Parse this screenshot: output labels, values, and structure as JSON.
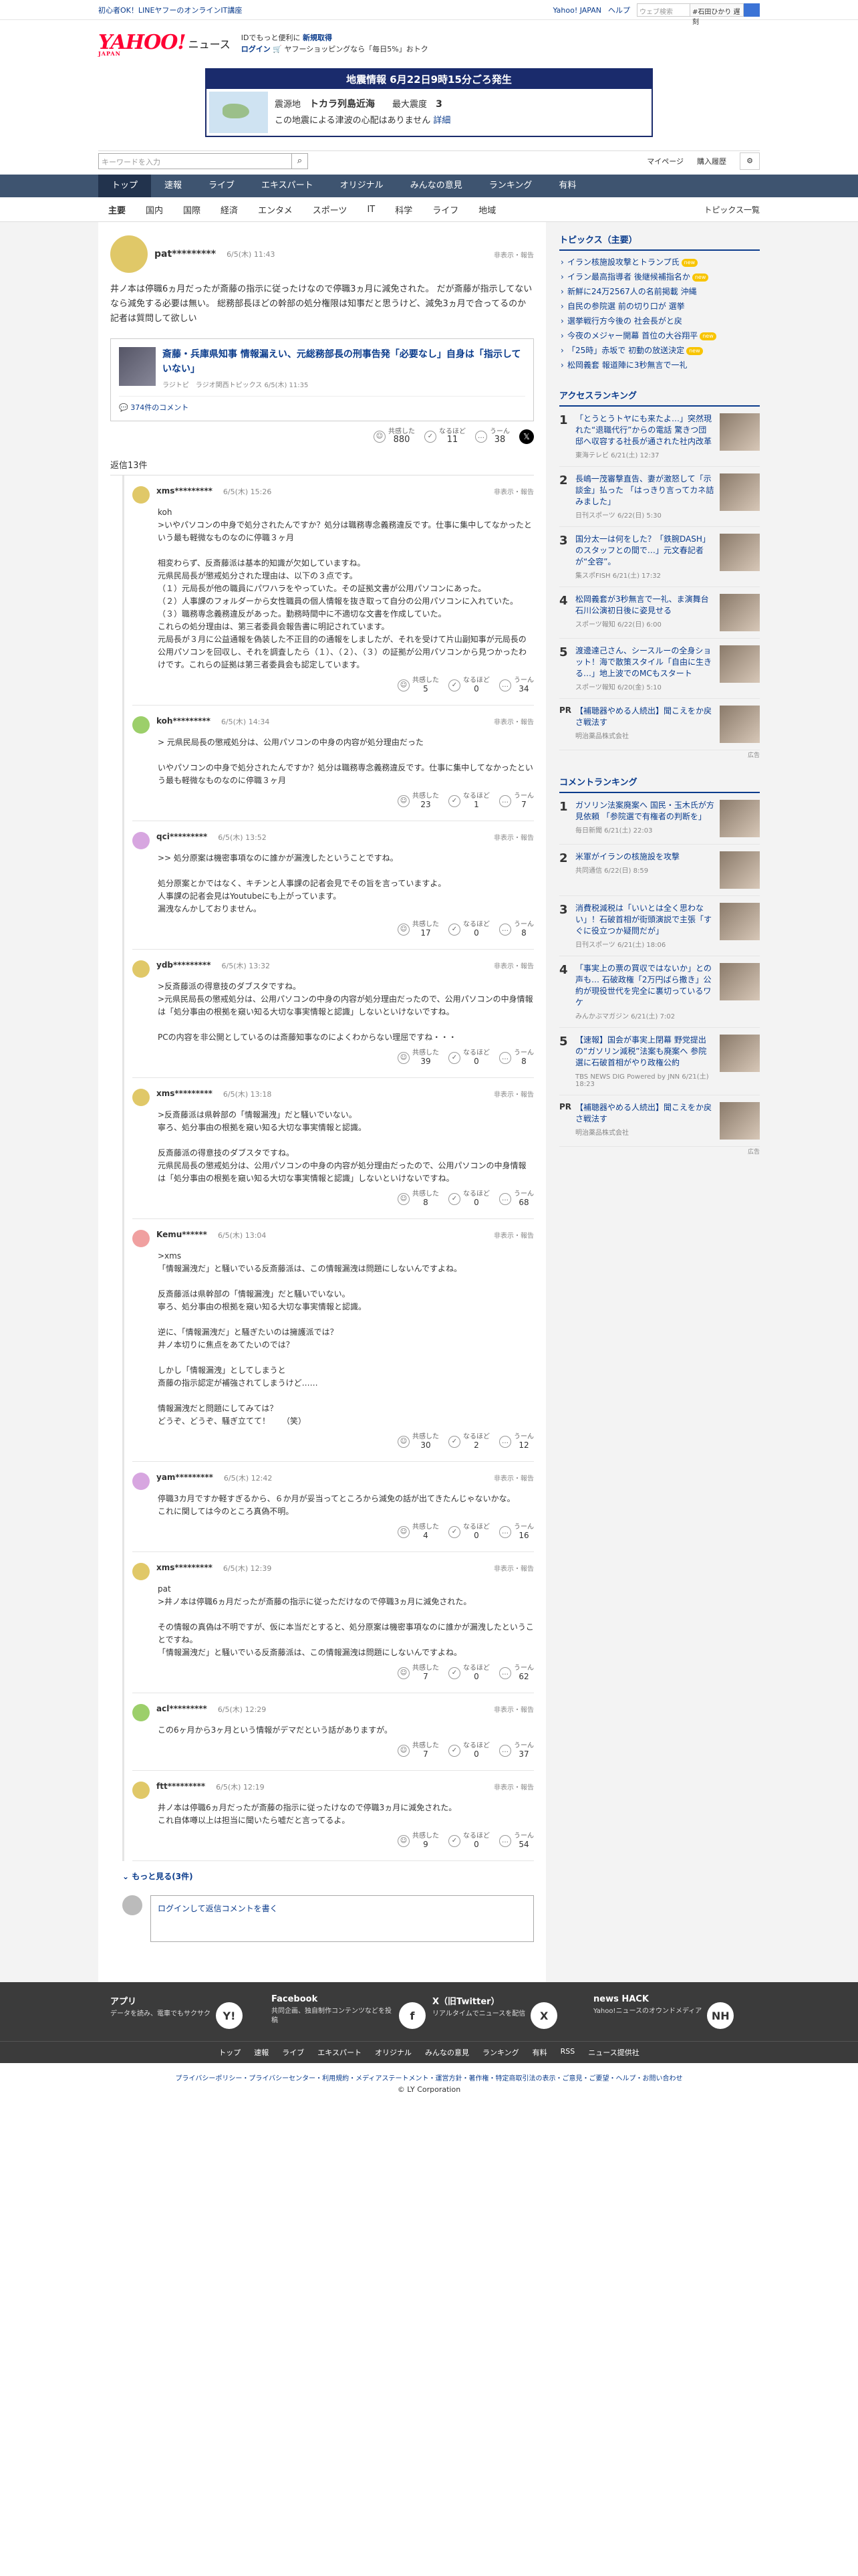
{
  "topbar": {
    "promo": "初心者OK！LINEヤフーのオンラインIT講座",
    "links": [
      "Yahoo! JAPAN",
      "ヘルプ"
    ],
    "search_placeholder": "ウェブ検索",
    "search_name": "#石田ひかり 遅刻"
  },
  "header": {
    "logo": "YAHOO!",
    "logo_sub": "JAPAN",
    "section": "ニュース",
    "line1_a": "IDでもっと便利に",
    "line1_b": "新規取得",
    "line2_a": "ログイン",
    "line2_b": "ヤフーショッピングなら「毎日5%」おトク"
  },
  "quake": {
    "title": "地震情報 6月22日9時15分ごろ発生",
    "loc_label": "震源地",
    "loc": "トカラ列島近海",
    "int_label": "最大震度",
    "int": "3",
    "note": "この地震による津波の心配はありません",
    "detail": "詳細"
  },
  "bar": {
    "search_placeholder": "キーワードを入力",
    "mypage": "マイページ",
    "history": "購入履歴"
  },
  "nav": [
    "トップ",
    "速報",
    "ライブ",
    "エキスパート",
    "オリジナル",
    "みんなの意見",
    "ランキング",
    "有料"
  ],
  "subnav": [
    "主要",
    "国内",
    "国際",
    "経済",
    "エンタメ",
    "スポーツ",
    "IT",
    "科学",
    "ライフ",
    "地域"
  ],
  "subnav_all": "トピックス一覧",
  "post": {
    "user": "pat*********",
    "date": "6/5(木) 11:43",
    "hide": "非表示・報告",
    "body": "井ノ本は停職6ヵ月だったが斎藤の指示に従ったけなので停職3ヵ月に減免された。 だが斎藤が指示してないなら減免する必要は無い。 総務部長ほどの幹部の処分権限は知事だと思うけど、減免3ヵ月で合ってるのか記者は質問して欲しい",
    "article_title": "斎藤・兵庫県知事 情報漏えい、元総務部長の刑事告発「必要なし」自身は「指示していない」",
    "article_src": "ラジトピ　ラジオ関西トピックス 6/5(木) 11:35",
    "article_count": "374件のコメント",
    "r1_label": "共感した",
    "r1": "880",
    "r2_label": "なるほど",
    "r2": "11",
    "r3_label": "うーん",
    "r3": "38"
  },
  "reply_count": "返信13件",
  "replies": [
    {
      "user": "xms*********",
      "date": "6/5(木) 15:26",
      "body": "koh\n>いやパソコンの中身で処分されたんですか？処分は職務専念義務違反です。仕事に集中してなかったという最も軽微なものなのに停職３ヶ月\n\n相変わらず、反斎藤派は基本的知識が欠如していますね。\n元県民局長が懲戒処分された理由は、以下の３点です。\n（１）元局長が他の職員にパワハラをやっていた。その証拠文書が公用パソコンにあった。\n（２）人事課のフォルダーから女性職員の個人情報を抜き取って自分の公用パソコンに入れていた。\n（３）職務専念義務違反があった。勤務時間中に不適切な文書を作成していた。\nこれらの処分理由は、第三者委員会報告書に明記されています。\n元局長が３月に公益通報を偽装した不正目的の通報をしましたが、それを受けて片山副知事が元局長の公用パソコンを回収し、それを調査したら（１）、（２）、（３）の証拠が公用パソコンから見つかったわけです。これらの証拠は第三者委員会も認定しています。",
      "r1": "5",
      "r2": "0",
      "r3": "34"
    },
    {
      "user": "koh*********",
      "date": "6/5(木) 14:34",
      "body": "> 元県民局長の懲戒処分は、公用パソコンの中身の内容が処分理由だった\n\nいやパソコンの中身で処分されたんですか？処分は職務専念義務違反です。仕事に集中してなかったという最も軽微なものなのに停職３ヶ月",
      "r1": "23",
      "r2": "1",
      "r3": "7"
    },
    {
      "user": "qci*********",
      "date": "6/5(木) 13:52",
      "body": ">> 処分原案は機密事項なのに誰かが漏洩したということですね。\n\n処分原案とかではなく、キチンと人事課の記者会見でその旨を言っていますよ。\n人事課の記者会見はYoutubeにも上がっています。\n漏洩なんかしておりません。",
      "r1": "17",
      "r2": "0",
      "r3": "8"
    },
    {
      "user": "ydb*********",
      "date": "6/5(木) 13:32",
      "body": ">反斎藤派の得意技のダブスタですね。\n>元県民局長の懲戒処分は、公用パソコンの中身の内容が処分理由だったので、公用パソコンの中身情報は「処分事由の根拠を窺い知る大切な事実情報と認識」しないといけないですね。\n\nPCの内容を非公開としているのは斎藤知事なのによくわからない理屈ですね・・・",
      "r1": "39",
      "r2": "0",
      "r3": "8"
    },
    {
      "user": "xms*********",
      "date": "6/5(木) 13:18",
      "body": ">反斎藤派は県幹部の「情報漏洩」だと騒いでいない。\n寧ろ、処分事由の根拠を窺い知る大切な事実情報と認識。\n\n反斎藤派の得意技のダブスタですね。\n元県民局長の懲戒処分は、公用パソコンの中身の内容が処分理由だったので、公用パソコンの中身情報は「処分事由の根拠を窺い知る大切な事実情報と認識」しないといけないですね。",
      "r1": "8",
      "r2": "0",
      "r3": "68"
    },
    {
      "user": "Kemu******",
      "date": "6/5(木) 13:04",
      "body": ">xms\n「情報漏洩だ」と騒いでいる反斎藤派は、この情報漏洩は問題にしないんですよね。\n\n反斎藤派は県幹部の「情報漏洩」だと騒いでいない。\n寧ろ、処分事由の根拠を窺い知る大切な事実情報と認識。\n\n逆に、「情報漏洩だ」と騒ぎたいのは擁護派では？\n井ノ本切りに焦点をあてたいのでは？\n\nしかし「情報漏洩」としてしまうと\n斎藤の指示認定が補強されてしまうけど……\n\n情報漏洩だと問題にしてみては？\nどうぞ、どうぞ、騒ぎ立てて！　　（笑）",
      "r1": "30",
      "r2": "2",
      "r3": "12"
    },
    {
      "user": "yam*********",
      "date": "6/5(木) 12:42",
      "body": "停職3カ月ですか軽すぎるから、６か月が妥当ってところから減免の話が出てきたんじゃないかな。\nこれに関しては今のところ真偽不明。",
      "r1": "4",
      "r2": "0",
      "r3": "16"
    },
    {
      "user": "xms*********",
      "date": "6/5(木) 12:39",
      "body": "pat\n>井ノ本は停職6ヵ月だったが斎藤の指示に従っただけなので停職3ヵ月に減免された。\n\nその情報の真偽は不明ですが、仮に本当だとすると、処分原案は機密事項なのに誰かが漏洩したということですね。\n「情報漏洩だ」と騒いでいる反斎藤派は、この情報漏洩は問題にしないんですよね。",
      "r1": "7",
      "r2": "0",
      "r3": "62"
    },
    {
      "user": "acl*********",
      "date": "6/5(木) 12:29",
      "body": "この6ヶ月から3ヶ月という情報がデマだという話がありますが。",
      "r1": "7",
      "r2": "0",
      "r3": "37"
    },
    {
      "user": "ftt*********",
      "date": "6/5(木) 12:19",
      "body": "井ノ本は停職6ヵ月だったが斎藤の指示に従ったけなので停職3ヵ月に減免された。\nこれ自体噂以上は担当に聞いたら嘘だと言ってるよ。",
      "r1": "9",
      "r2": "0",
      "r3": "54"
    }
  ],
  "react_labels": [
    "共感した",
    "なるほど",
    "うーん"
  ],
  "hide_label": "非表示・報告",
  "more": "もっと見る(3件)",
  "comment_login": "ログイン",
  "comment_rest": "して返信コメントを書く",
  "side": {
    "topics_title": "トピックス（主要）",
    "topics": [
      "イラン核施設攻撃とトランプ氏",
      "イラン最高指導者 後継候補指名か",
      "新鮮に24万2567人の名前掲載 沖縄",
      "自民の参院選 前の切り口が 選挙",
      "選挙戦行方今後の 社会長がと戻",
      "今夜のメジャー開幕 首位の大谷翔平",
      "「25時」赤坂で 初動の放送決定",
      "松岡義套 報道陣に3秒無言で一礼"
    ],
    "access_title": "アクセスランキング",
    "access": [
      {
        "n": "1",
        "t": "「とうとうトヤにも来たよ…」突然現れた“退職代行”からの電話 驚きつ団邸へ収容する社長が通された社内改革",
        "s": "東海テレビ 6/21(土) 12:37"
      },
      {
        "n": "2",
        "t": "長嶋一茂審撃直告、妻が激怒して「示談金」払った 「はっきり言ってカネ詰みました」",
        "s": "日刊スポーツ 6/22(日) 5:30"
      },
      {
        "n": "3",
        "t": "国分太一は何をした？「鉄腕DASH」のスタッフとの間で…」元文春記者が“全容”。",
        "s": "集スポFISH 6/21(土) 17:32"
      },
      {
        "n": "4",
        "t": "松岡義套が3秒無言で一礼、ま演舞台石川公演初日後に姿見せる",
        "s": "スポーツ報知 6/22(日) 6:00"
      },
      {
        "n": "5",
        "t": "渡邊達己さん、シースルーの全身ショット！海で散策スタイル「自由に生きる…」地上波でのMCもスタート",
        "s": "スポーツ報知 6/20(金) 5:10"
      }
    ],
    "pr1": {
      "t": "【補聴器やめる人続出】聞こえをか戻さ戦法す",
      "s": "明治薬品株式会社"
    },
    "comment_title": "コメントランキング",
    "comments": [
      {
        "n": "1",
        "t": "ガソリン法案廃案へ 国民・玉木氏が方見依頼 「参院選で有権者の判断を」",
        "s": "毎日新聞 6/21(土) 22:03"
      },
      {
        "n": "2",
        "t": "米軍がイランの核施設を攻撃",
        "s": "共同通信 6/22(日) 8:59"
      },
      {
        "n": "3",
        "t": "消費税減税は「いいとは全く思わない」！石破首相が街頭演説で主張「すぐに役立つか疑問だが」",
        "s": "日刊スポーツ 6/21(土) 18:06"
      },
      {
        "n": "4",
        "t": "「事実上の票の買収ではないか」との声も… 石破政権「2万円ばら撒き」公約が現役世代を完全に裏切っているワケ",
        "s": "みんかぶマガジン 6/21(土) 7:02"
      },
      {
        "n": "5",
        "t": "【速報】国会が事実上閉幕 野党提出の“ガソリン減税”法案も廃案へ 参院選に石破首相がやり政権公約",
        "s": "TBS NEWS DIG Powered by JNN 6/21(土) 18:23"
      }
    ],
    "pr2": {
      "t": "【補聴器やめる人続出】聞こえをか戻さ戦法す",
      "s": "明治薬品株式会社"
    },
    "ad": "広告"
  },
  "footer": {
    "cols": [
      {
        "t": "アプリ",
        "d": "データを読み、電車でもサクサク",
        "icon": "Y!"
      },
      {
        "t": "Facebook",
        "d": "共同企画、独自制作コンテンツなどを投稿",
        "icon": "f"
      },
      {
        "t": "X（旧Twitter）",
        "d": "リアルタイムでニュースを配信",
        "icon": "X"
      },
      {
        "t": "news HACK",
        "d": "Yahoo!ニュースのオウンドメディア",
        "icon": "NH"
      }
    ],
    "links": [
      "トップ",
      "速報",
      "ライブ",
      "エキスパート",
      "オリジナル",
      "みんなの意見",
      "ランキング",
      "有料",
      "RSS",
      "ニュース提供社"
    ],
    "legal": "プライバシーポリシー・プライバシーセンター・利用規約・メディアステートメント・運営方針・著作権・特定商取引法の表示・ご意見・ご要望・ヘルプ・お問い合わせ",
    "copy": "© LY Corporation"
  },
  "colors": {
    "brand": "#ff0033",
    "nav": "#3e5470",
    "link": "#0b3c8c"
  }
}
